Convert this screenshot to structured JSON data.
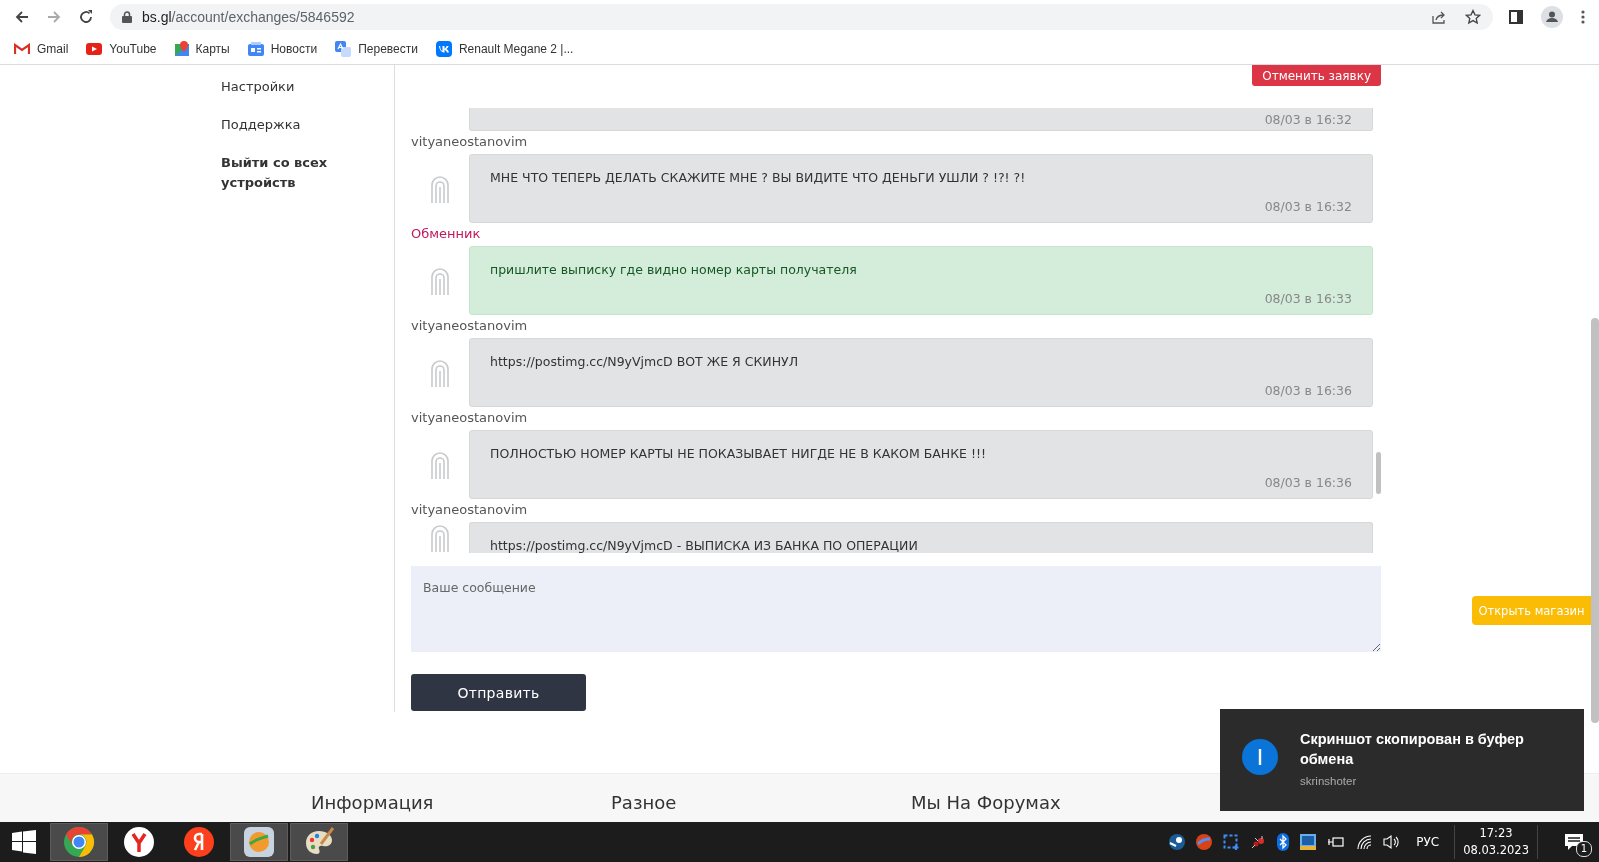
{
  "browser": {
    "url_host": "bs.gl",
    "url_path": "/account/exchanges/5846592",
    "bookmarks": [
      {
        "kind": "mail",
        "label": "Gmail"
      },
      {
        "kind": "video",
        "label": "YouTube"
      },
      {
        "kind": "maps",
        "label": "Карты"
      },
      {
        "kind": "news",
        "label": "Новости"
      },
      {
        "kind": "translate",
        "label": "Перевести"
      },
      {
        "kind": "social",
        "label": "Renault Megane 2 |..."
      }
    ]
  },
  "sidebar": {
    "items": [
      {
        "kind": "link",
        "label": "Настройки"
      },
      {
        "kind": "link",
        "label": "Поддержка"
      },
      {
        "kind": "action",
        "label": "Выйти со всех устройств"
      }
    ]
  },
  "chat": {
    "cancel_button": "Отменить заявку",
    "messages": [
      {
        "kind": "user",
        "time": "08/03 в 16:32"
      },
      {
        "kind": "user",
        "author": "vityaneostanovim",
        "text": "МНЕ ЧТО ТЕПЕРЬ ДЕЛАТЬ СКАЖИТЕ МНЕ ? ВЫ ВИДИТЕ ЧТО ДЕНЬГИ УШЛИ ? !?! ?!",
        "time": "08/03 в 16:32"
      },
      {
        "kind": "exchanger",
        "author": "Обменник",
        "text": "пришлите выписку где видно номер карты получателя",
        "time": "08/03 в 16:33"
      },
      {
        "kind": "user",
        "author": "vityaneostanovim",
        "text": "https://postimg.cc/N9yVjmcD ВОТ ЖЕ Я СКИНУЛ",
        "time": "08/03 в 16:36"
      },
      {
        "kind": "user",
        "author": "vityaneostanovim",
        "text": "ПОЛНОСТЬЮ НОМЕР КАРТЫ НЕ ПОКАЗЫВАЕТ НИГДЕ НЕ В КАКОМ БАНКЕ !!!",
        "time": "08/03 в 16:36"
      },
      {
        "kind": "user",
        "author": "vityaneostanovim",
        "text": "https://postimg.cc/N9yVjmcD - ВЫПИСКА ИЗ БАНКА ПО ОПЕРАЦИИ"
      }
    ]
  },
  "composer": {
    "placeholder": "Ваше сообщение",
    "send_button": "Отправить"
  },
  "shop_button": "Открыть магазин",
  "footer": {
    "headings": [
      "Информация",
      "Разное",
      "Мы На Форумах"
    ]
  },
  "toast": {
    "title": "Скриншот скопирован в буфер обмена",
    "source": "skrinshoter"
  },
  "taskbar": {
    "apps": [
      {
        "kind": "chrome",
        "open": true
      },
      {
        "kind": "ybrowser",
        "open": false
      },
      {
        "kind": "yandex",
        "open": false
      },
      {
        "kind": "disk",
        "open": true
      },
      {
        "kind": "paint",
        "open": true
      }
    ],
    "language": "РУС",
    "time": "17:23",
    "date": "08.03.2023",
    "notifications": "1"
  }
}
